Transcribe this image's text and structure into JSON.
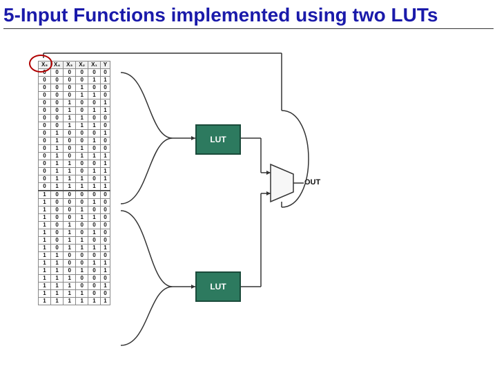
{
  "title": "5-Input Functions implemented using two LUTs",
  "columns": [
    "X₅",
    "X₄",
    "X₃",
    "X₂",
    "X₁",
    "Y"
  ],
  "rows": [
    [
      "0",
      "0",
      "0",
      "0",
      "0",
      "0"
    ],
    [
      "0",
      "0",
      "0",
      "0",
      "1",
      "1"
    ],
    [
      "0",
      "0",
      "0",
      "1",
      "0",
      "0"
    ],
    [
      "0",
      "0",
      "0",
      "1",
      "1",
      "0"
    ],
    [
      "0",
      "0",
      "1",
      "0",
      "0",
      "1"
    ],
    [
      "0",
      "0",
      "1",
      "0",
      "1",
      "1"
    ],
    [
      "0",
      "0",
      "1",
      "1",
      "0",
      "0"
    ],
    [
      "0",
      "0",
      "1",
      "1",
      "1",
      "0"
    ],
    [
      "0",
      "1",
      "0",
      "0",
      "0",
      "1"
    ],
    [
      "0",
      "1",
      "0",
      "0",
      "1",
      "0"
    ],
    [
      "0",
      "1",
      "0",
      "1",
      "0",
      "0"
    ],
    [
      "0",
      "1",
      "0",
      "1",
      "1",
      "1"
    ],
    [
      "0",
      "1",
      "1",
      "0",
      "0",
      "1"
    ],
    [
      "0",
      "1",
      "1",
      "0",
      "1",
      "1"
    ],
    [
      "0",
      "1",
      "1",
      "1",
      "0",
      "1"
    ],
    [
      "0",
      "1",
      "1",
      "1",
      "1",
      "1"
    ],
    [
      "1",
      "0",
      "0",
      "0",
      "0",
      "0"
    ],
    [
      "1",
      "0",
      "0",
      "0",
      "1",
      "0"
    ],
    [
      "1",
      "0",
      "0",
      "1",
      "0",
      "0"
    ],
    [
      "1",
      "0",
      "0",
      "1",
      "1",
      "0"
    ],
    [
      "1",
      "0",
      "1",
      "0",
      "0",
      "0"
    ],
    [
      "1",
      "0",
      "1",
      "0",
      "1",
      "0"
    ],
    [
      "1",
      "0",
      "1",
      "1",
      "0",
      "0"
    ],
    [
      "1",
      "0",
      "1",
      "1",
      "1",
      "1"
    ],
    [
      "1",
      "1",
      "0",
      "0",
      "0",
      "0"
    ],
    [
      "1",
      "1",
      "0",
      "0",
      "1",
      "1"
    ],
    [
      "1",
      "1",
      "0",
      "1",
      "0",
      "1"
    ],
    [
      "1",
      "1",
      "1",
      "0",
      "0",
      "0"
    ],
    [
      "1",
      "1",
      "1",
      "0",
      "0",
      "1"
    ],
    [
      "1",
      "1",
      "1",
      "1",
      "0",
      "0"
    ],
    [
      "1",
      "1",
      "1",
      "1",
      "1",
      "1"
    ]
  ],
  "lut_label": "LUT",
  "out_label": "OUT"
}
